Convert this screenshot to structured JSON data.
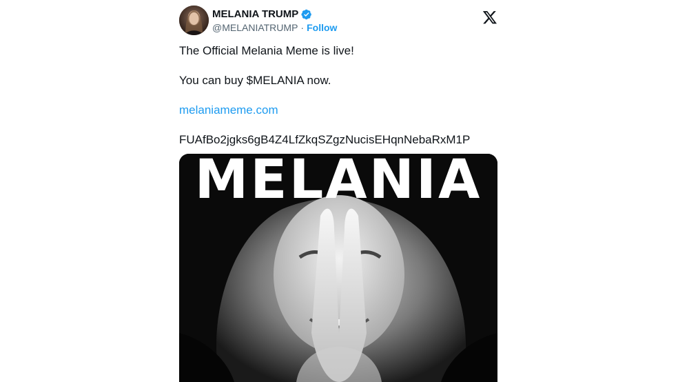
{
  "author": {
    "display_name": "MELANIA TRUMP",
    "handle": "@MELANIATRUMP",
    "separator": "·",
    "follow_label": "Follow",
    "verified_icon": "verified-badge-icon",
    "avatar_icon": "avatar"
  },
  "platform_icon": "x-logo-icon",
  "tweet": {
    "line1": "The Official Melania Meme is live!",
    "line2": "You can buy $MELANIA now.",
    "link": "melaniameme.com",
    "address": "FUAfBo2jgks6gB4Z4LfZkqSZgzNucisEHqnNebaRxM1P"
  },
  "media": {
    "overlay_text": "MELANIA"
  },
  "colors": {
    "accent": "#1d9bf0",
    "text": "#0f1419",
    "secondary": "#536471"
  }
}
